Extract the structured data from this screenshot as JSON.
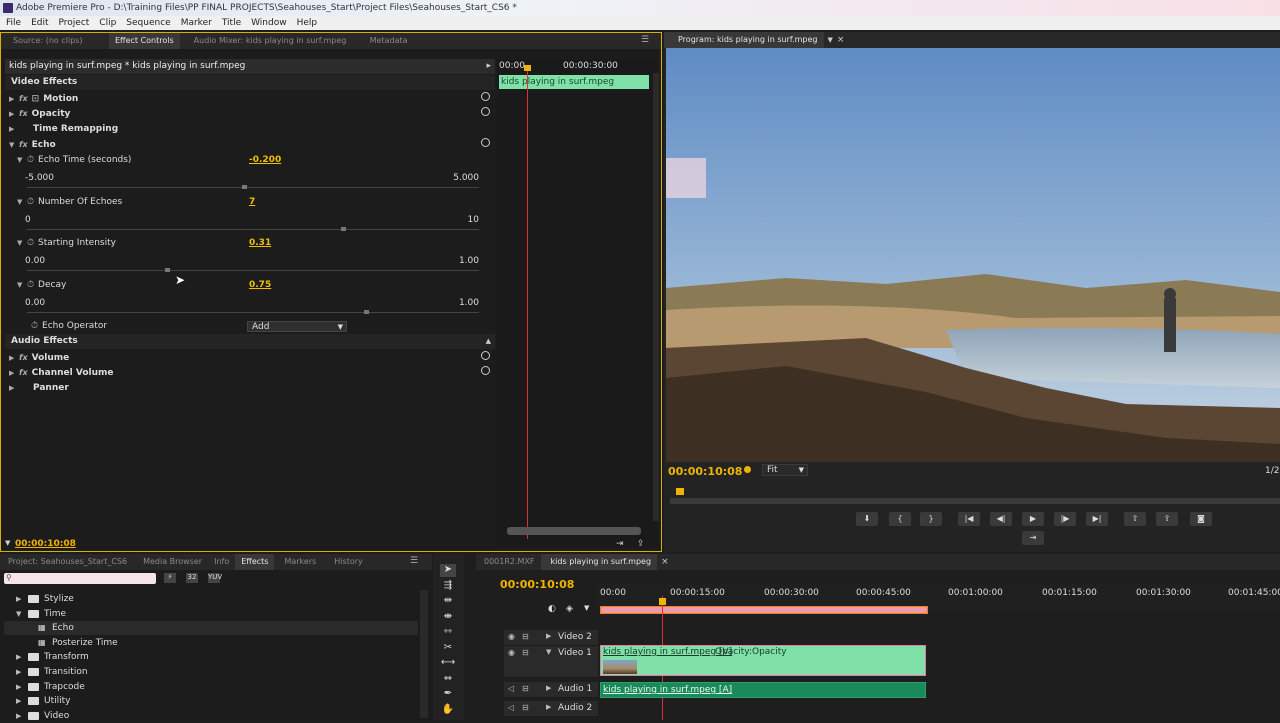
{
  "app": {
    "title": "Adobe Premiere Pro - D:\\Training Files\\PP FINAL PROJECTS\\Seahouses_Start\\Project Files\\Seahouses_Start_CS6 *"
  },
  "menu": [
    "File",
    "Edit",
    "Project",
    "Clip",
    "Sequence",
    "Marker",
    "Title",
    "Window",
    "Help"
  ],
  "effect_panel": {
    "tabs": [
      "Source: (no clips)",
      "Effect Controls",
      "Audio Mixer: kids playing in surf.mpeg",
      "Metadata"
    ],
    "clip_title": "kids playing in surf.mpeg * kids playing in surf.mpeg",
    "mini_timeline": {
      "start": "00:00",
      "mark": "00:00:30:00",
      "clip": "kids playing in surf.mpeg"
    },
    "video_effects": "Video Effects",
    "motion": "Motion",
    "opacity": "Opacity",
    "time_remap": "Time Remapping",
    "echo": "Echo",
    "params": [
      {
        "label": "Echo Time (seconds)",
        "value": "-0.200",
        "min": "-5.000",
        "max": "5.000",
        "pos": 0.48
      },
      {
        "label": "Number Of Echoes",
        "value": "7",
        "min": "0",
        "max": "10",
        "pos": 0.7
      },
      {
        "label": "Starting Intensity",
        "value": "0.31",
        "min": "0.00",
        "max": "1.00",
        "pos": 0.31
      },
      {
        "label": "Decay",
        "value": "0.75",
        "min": "0.00",
        "max": "1.00",
        "pos": 0.75
      }
    ],
    "echo_operator": {
      "label": "Echo Operator",
      "value": "Add"
    },
    "audio_effects": "Audio Effects",
    "volume": "Volume",
    "channel_volume": "Channel Volume",
    "panner": "Panner",
    "timecode": "00:00:10:08"
  },
  "program": {
    "tab": "Program: kids playing in surf.mpeg",
    "timecode": "00:00:10:08",
    "fit": "Fit",
    "ratio": "1/2"
  },
  "project_panel": {
    "tabs": [
      "Project: Seahouses_Start_CS6",
      "Media Browser",
      "Info",
      "Effects",
      "Markers",
      "History"
    ],
    "tree": [
      {
        "label": "Stylize",
        "level": 1
      },
      {
        "label": "Time",
        "level": 1,
        "open": true
      },
      {
        "label": "Echo",
        "level": 2,
        "selected": true
      },
      {
        "label": "Posterize Time",
        "level": 2
      },
      {
        "label": "Transform",
        "level": 1
      },
      {
        "label": "Transition",
        "level": 1
      },
      {
        "label": "Trapcode",
        "level": 1
      },
      {
        "label": "Utility",
        "level": 1
      },
      {
        "label": "Video",
        "level": 1
      }
    ]
  },
  "timeline": {
    "tabs": [
      "0001R2.MXF",
      "kids playing in surf.mpeg"
    ],
    "timecode": "00:00:10:08",
    "ruler": [
      "00:00",
      "00:00:15:00",
      "00:00:30:00",
      "00:00:45:00",
      "00:01:00:00",
      "00:01:15:00",
      "00:01:30:00",
      "00:01:45:00"
    ],
    "tracks": [
      "Video 2",
      "Video 1",
      "Audio 1",
      "Audio 2"
    ],
    "video_clip": "kids playing in surf.mpeg [V]",
    "opacity_label": "Opacity:Opacity",
    "audio_clip": "kids playing in surf.mpeg [A]"
  },
  "colors": {
    "timecode": "#f0b400",
    "clip_video": "#7fe0a8",
    "clip_pink": "#e87aa8",
    "playhead": "#e03030"
  }
}
